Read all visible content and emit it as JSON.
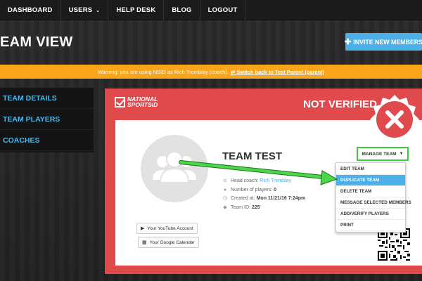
{
  "nav": {
    "items": [
      {
        "label": "DASHBOARD"
      },
      {
        "label": "USERS",
        "caret": "⌄"
      },
      {
        "label": "HELP DESK"
      },
      {
        "label": "BLOG"
      },
      {
        "label": "LOGOUT"
      }
    ]
  },
  "header": {
    "title": "EAM VIEW",
    "invite_label": "INVITE NEW MEMBERS"
  },
  "warning": {
    "text": "Warning: you are using NSID as Rich Tremblay (coach).",
    "switch_link": "Switch back to Test Parent (parent)"
  },
  "sidebar": {
    "items": [
      {
        "label": "TEAM DETAILS"
      },
      {
        "label": "TEAM PLAYERS"
      },
      {
        "label": "COACHES"
      }
    ]
  },
  "card": {
    "logo_line1": "NATIONAL",
    "logo_line2": "SPORTSID",
    "status": "NOT VERIFIED",
    "team_name": "TEAM TEST",
    "head_coach_label": "Head coach:",
    "head_coach": "Rich Tremblay",
    "players_label": "Number of players:",
    "players": "0",
    "created_label": "Created at:",
    "created": "Mon 11/21/16 7:24pm",
    "team_id_label": "Team ID:",
    "team_id": "225",
    "youtube_label": "Your YouTube Account",
    "calendar_label": "Your Google Calendar"
  },
  "manage": {
    "label": "MANAGE TEAM",
    "options": [
      {
        "label": "EDIT TEAM"
      },
      {
        "label": "DUPLICATE TEAM",
        "active": true
      },
      {
        "label": "DELETE TEAM"
      },
      {
        "label": "MESSAGE SELECTED MEMBERS"
      },
      {
        "label": "ADD/VERIFY PLAYERS"
      },
      {
        "label": "PRINT"
      }
    ]
  },
  "colors": {
    "accent": "#4db0e8",
    "warning": "#f8a51b",
    "card": "#e04a4d",
    "highlight": "#3fca3f"
  }
}
